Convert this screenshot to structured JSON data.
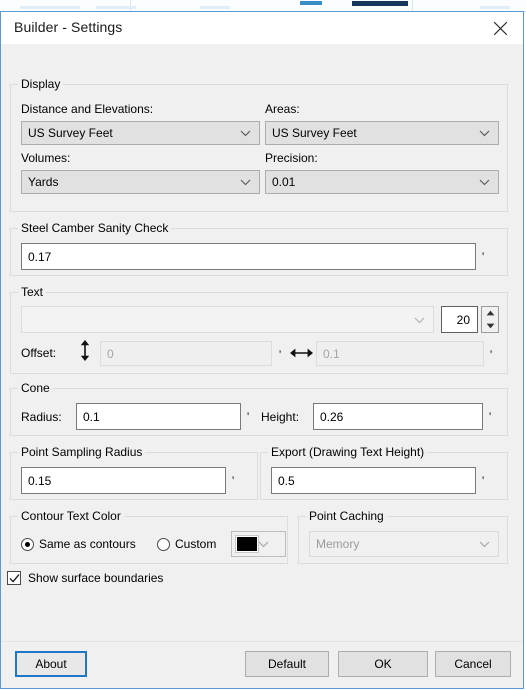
{
  "window": {
    "title": "Builder - Settings",
    "close_icon": "close-icon",
    "accent_color": "#1e78c8",
    "border_color": "#5b9bd5"
  },
  "display_group": {
    "title": "Display",
    "distance_label": "Distance and Elevations:",
    "distance_value": "US Survey Feet",
    "areas_label": "Areas:",
    "areas_value": "US Survey Feet",
    "volumes_label": "Volumes:",
    "volumes_value": "Yards",
    "precision_label": "Precision:",
    "precision_value": "0.01"
  },
  "steel_camber_group": {
    "title": "Steel Camber Sanity Check",
    "value": "0.17",
    "unit": "'"
  },
  "text_group": {
    "title": "Text",
    "style_value": "",
    "style_placeholder": "",
    "size_value": "20",
    "offset_label": "Offset:",
    "vertical_icon": "arrows-vertical-icon",
    "vertical_value": "0",
    "vertical_unit": "'",
    "horizontal_icon": "arrows-horizontal-icon",
    "horizontal_value": "0.1",
    "horizontal_unit": "'"
  },
  "cone_group": {
    "title": "Cone",
    "radius_label": "Radius:",
    "radius_value": "0.1",
    "radius_unit": "'",
    "height_label": "Height:",
    "height_value": "0.26",
    "height_unit": "'"
  },
  "point_sampling_group": {
    "title": "Point Sampling Radius",
    "value": "0.15",
    "unit": "'"
  },
  "export_group": {
    "title": "Export (Drawing Text Height)",
    "value": "0.5",
    "unit": "'"
  },
  "contour_text_color_group": {
    "title": "Contour Text Color",
    "same_as_contours_label": "Same as contours",
    "same_as_contours_selected": true,
    "custom_label": "Custom",
    "custom_selected": false,
    "swatch_color": "#000000"
  },
  "point_caching_group": {
    "title": "Point Caching",
    "value": "Memory"
  },
  "show_surface_boundaries": {
    "label": "Show surface boundaries",
    "checked": true
  },
  "footer": {
    "about_label": "About",
    "default_label": "Default",
    "ok_label": "OK",
    "cancel_label": "Cancel"
  }
}
